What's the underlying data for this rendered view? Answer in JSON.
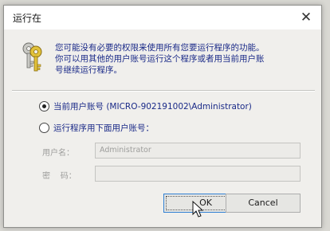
{
  "window": {
    "title": "运行在",
    "close_glyph": "✕"
  },
  "message": {
    "line1": "您可能没有必要的权限来使用所有您要运行程序的功能。",
    "line2": "你可以用其他的用户账号运行这个程序或者用当前用户账",
    "line3": "号继续运行程序。"
  },
  "options": {
    "current_user_label": "当前用户账号 (MICRO-902191002\\Administrator)",
    "current_user_selected": true,
    "other_user_label": "运行程序用下面用户账号：",
    "other_user_selected": false
  },
  "fields": {
    "username_label": "用户名：",
    "username_value": "Administrator",
    "password_label": "密    码：",
    "password_value": ""
  },
  "buttons": {
    "ok_label": "OK",
    "cancel_label": "Cancel"
  },
  "icons": {
    "dialog_icon": "keys-icon",
    "cursor": "mouse-pointer-icon"
  },
  "colors": {
    "text_blue": "#1a2a88",
    "disabled_gray": "#9d9d9b",
    "focus_blue": "#2f7fd2"
  }
}
